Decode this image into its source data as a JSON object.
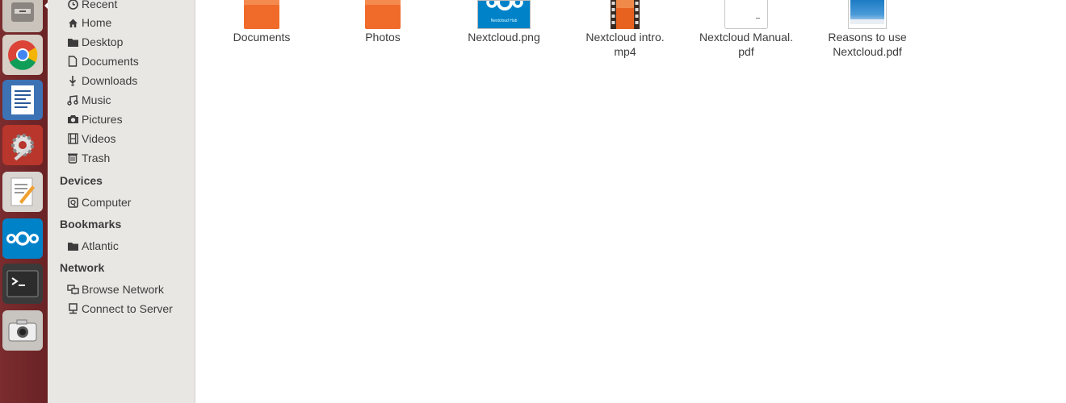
{
  "launcher": {
    "items": [
      {
        "name": "files"
      },
      {
        "name": "chrome"
      },
      {
        "name": "writer"
      },
      {
        "name": "settings"
      },
      {
        "name": "text-editor"
      },
      {
        "name": "nextcloud"
      },
      {
        "name": "terminal"
      },
      {
        "name": "camera"
      }
    ]
  },
  "sidebar": {
    "places": [
      {
        "label": "Recent",
        "icon": "clock-icon"
      },
      {
        "label": "Home",
        "icon": "home-icon"
      },
      {
        "label": "Desktop",
        "icon": "folder-icon"
      },
      {
        "label": "Documents",
        "icon": "document-icon"
      },
      {
        "label": "Downloads",
        "icon": "download-icon"
      },
      {
        "label": "Music",
        "icon": "music-icon"
      },
      {
        "label": "Pictures",
        "icon": "camera-icon"
      },
      {
        "label": "Videos",
        "icon": "film-icon"
      },
      {
        "label": "Trash",
        "icon": "trash-icon"
      }
    ],
    "devices_heading": "Devices",
    "devices": [
      {
        "label": "Computer",
        "icon": "drive-icon"
      }
    ],
    "bookmarks_heading": "Bookmarks",
    "bookmarks": [
      {
        "label": "Atlantic",
        "icon": "folder-icon"
      }
    ],
    "network_heading": "Network",
    "network": [
      {
        "label": "Browse Network",
        "icon": "network-icon"
      },
      {
        "label": "Connect to Server",
        "icon": "server-icon"
      }
    ]
  },
  "files": [
    {
      "name_line1": "Documents",
      "name_line2": "",
      "icon": "folder-icon"
    },
    {
      "name_line1": "Photos",
      "name_line2": "",
      "icon": "folder-icon"
    },
    {
      "name_line1": "Nextcloud.png",
      "name_line2": "",
      "icon": "image-icon",
      "thumb_text": "Nextcloud Hub"
    },
    {
      "name_line1": "Nextcloud intro.",
      "name_line2": "mp4",
      "icon": "video-icon"
    },
    {
      "name_line1": "Nextcloud Manual.",
      "name_line2": "pdf",
      "icon": "pdf-icon"
    },
    {
      "name_line1": "Reasons to use",
      "name_line2": "Nextcloud.pdf",
      "icon": "pdf-icon"
    }
  ],
  "colors": {
    "launcher": "#6e2426",
    "sidebar": "#e8e7e4",
    "folder_orange": "#ec6a2d",
    "nextcloud_blue": "#0082c9"
  }
}
